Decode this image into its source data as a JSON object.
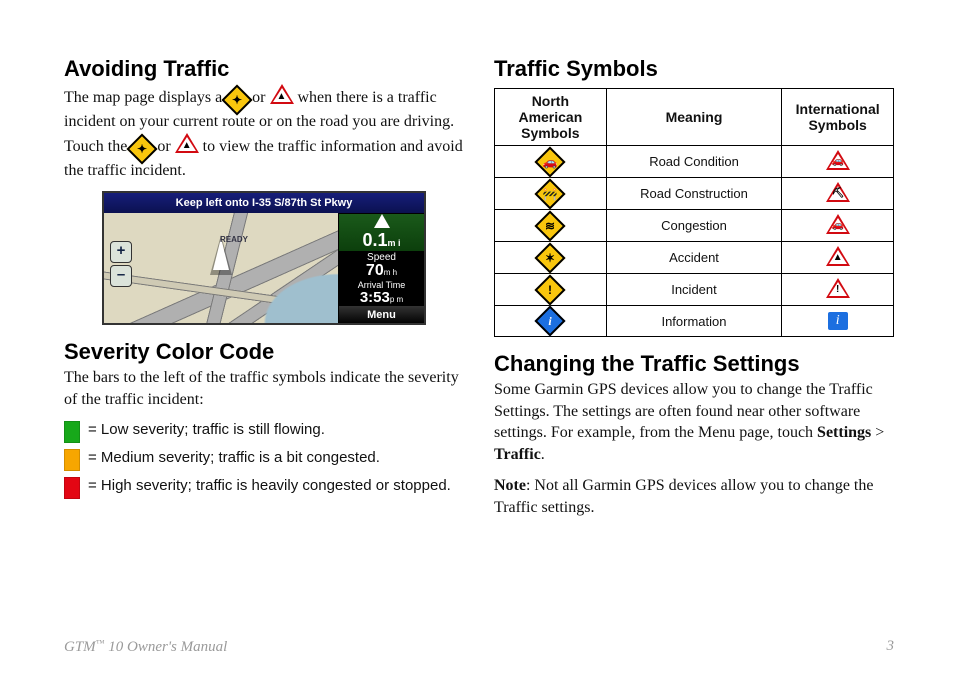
{
  "left": {
    "h_avoid": "Avoiding Traffic",
    "p_avoid_1a": "The map page displays a ",
    "p_avoid_1b": " or ",
    "p_avoid_1c": " when there is a traffic incident on your current route or on the road you are driving. Touch the ",
    "p_avoid_1d": " or ",
    "p_avoid_1e": " to view the traffic information and avoid the traffic incident.",
    "map": {
      "banner": "Keep left onto I-35 S/87th St Pkwy",
      "ready": "READY",
      "zoom_in": "+",
      "zoom_out": "–",
      "dist_value": "0.1",
      "dist_unit": "m i",
      "speed_label": "Speed",
      "speed_value": "70",
      "speed_unit": "m h",
      "time_label": "Arrival Time",
      "time_value": "3:53",
      "time_unit": "p m",
      "menu": "Menu"
    },
    "h_severity": "Severity Color Code",
    "p_severity": "The bars to the left of the traffic symbols indicate the severity of the traffic incident:",
    "sev": [
      "= Low severity; traffic is still flowing.",
      "= Medium severity; traffic is a bit congested.",
      "= High severity; traffic is heavily congested or stopped."
    ]
  },
  "right": {
    "h_symbols": "Traffic Symbols",
    "table": {
      "head_na": "North American Symbols",
      "head_meaning": "Meaning",
      "head_intl": "International Symbols",
      "rows": [
        {
          "meaning": "Road Condition"
        },
        {
          "meaning": "Road Construction"
        },
        {
          "meaning": "Congestion"
        },
        {
          "meaning": "Accident"
        },
        {
          "meaning": "Incident"
        },
        {
          "meaning": "Information"
        }
      ]
    },
    "h_changing": "Changing the Traffic Settings",
    "p_changing_1a": "Some Garmin GPS devices allow you to change the Traffic Settings. The settings are often found near other software settings. For example, from the Menu page, touch ",
    "b_settings": "Settings",
    "gt": " > ",
    "b_traffic": "Traffic",
    "period": ".",
    "p_note_label": "Note",
    "p_note_rest": ": Not all Garmin GPS devices allow you to change the Traffic settings."
  },
  "footer": {
    "left_a": "GTM",
    "left_tm": "™",
    "left_b": " 10 Owner's Manual",
    "page": "3"
  }
}
